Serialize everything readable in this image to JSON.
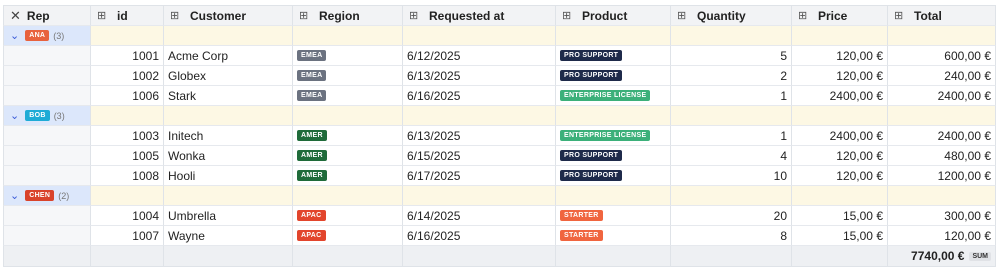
{
  "columns": [
    {
      "label": "Rep",
      "icon": "close-icon"
    },
    {
      "label": "id",
      "icon": "relation-icon"
    },
    {
      "label": "Customer",
      "icon": "relation-icon"
    },
    {
      "label": "Region",
      "icon": "relation-icon"
    },
    {
      "label": "Requested at",
      "icon": "relation-icon"
    },
    {
      "label": "Product",
      "icon": "relation-icon"
    },
    {
      "label": "Quantity",
      "icon": "relation-icon"
    },
    {
      "label": "Price",
      "icon": "relation-icon"
    },
    {
      "label": "Total",
      "icon": "relation-icon"
    }
  ],
  "colors": {
    "ANA": "#e8623d",
    "BOB": "#1eabd6",
    "CHEN": "#d9432b",
    "EMEA": "#6b7280",
    "AMER": "#1f6b3a",
    "APAC": "#e2452c",
    "PRO SUPPORT": "#1e2a4a",
    "ENTERPRISE LICENSE": "#3bb07a",
    "STARTER": "#f0653f"
  },
  "groups": [
    {
      "rep": "ANA",
      "count": "(3)",
      "rows": [
        {
          "id": "1001",
          "customer": "Acme Corp",
          "region": "EMEA",
          "requested": "6/12/2025",
          "product": "PRO SUPPORT",
          "qty": "5",
          "price": "120,00 €",
          "total": "600,00 €"
        },
        {
          "id": "1002",
          "customer": "Globex",
          "region": "EMEA",
          "requested": "6/13/2025",
          "product": "PRO SUPPORT",
          "qty": "2",
          "price": "120,00 €",
          "total": "240,00 €"
        },
        {
          "id": "1006",
          "customer": "Stark",
          "region": "EMEA",
          "requested": "6/16/2025",
          "product": "ENTERPRISE LICENSE",
          "qty": "1",
          "price": "2400,00 €",
          "total": "2400,00 €"
        }
      ]
    },
    {
      "rep": "BOB",
      "count": "(3)",
      "rows": [
        {
          "id": "1003",
          "customer": "Initech",
          "region": "AMER",
          "requested": "6/13/2025",
          "product": "ENTERPRISE LICENSE",
          "qty": "1",
          "price": "2400,00 €",
          "total": "2400,00 €"
        },
        {
          "id": "1005",
          "customer": "Wonka",
          "region": "AMER",
          "requested": "6/15/2025",
          "product": "PRO SUPPORT",
          "qty": "4",
          "price": "120,00 €",
          "total": "480,00 €"
        },
        {
          "id": "1008",
          "customer": "Hooli",
          "region": "AMER",
          "requested": "6/17/2025",
          "product": "PRO SUPPORT",
          "qty": "10",
          "price": "120,00 €",
          "total": "1200,00 €"
        }
      ]
    },
    {
      "rep": "CHEN",
      "count": "(2)",
      "rows": [
        {
          "id": "1004",
          "customer": "Umbrella",
          "region": "APAC",
          "requested": "6/14/2025",
          "product": "STARTER",
          "qty": "20",
          "price": "15,00 €",
          "total": "300,00 €"
        },
        {
          "id": "1007",
          "customer": "Wayne",
          "region": "APAC",
          "requested": "6/16/2025",
          "product": "STARTER",
          "qty": "8",
          "price": "15,00 €",
          "total": "120,00 €"
        }
      ]
    }
  ],
  "footer": {
    "total": "7740,00 €",
    "aggregate": "SUM"
  }
}
